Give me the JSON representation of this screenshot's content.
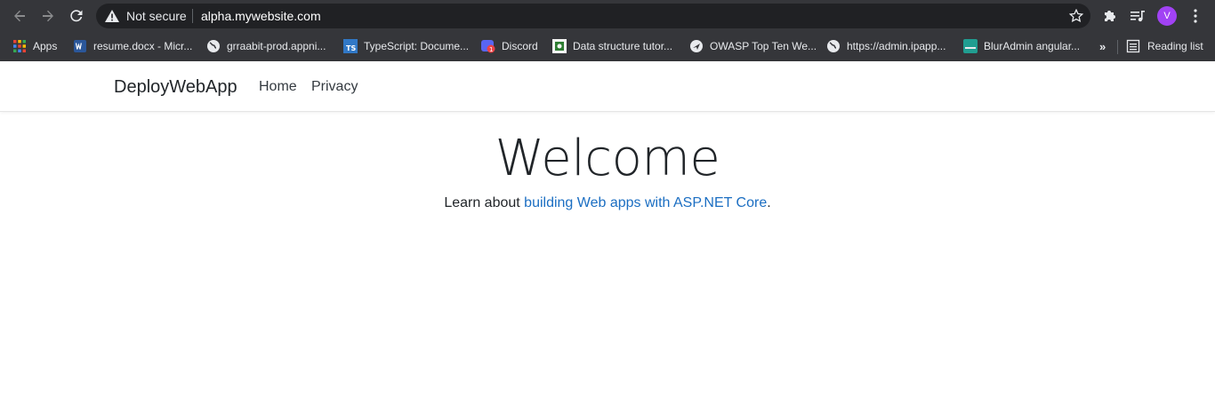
{
  "browser": {
    "security_label": "Not secure",
    "url": "alpha.mywebsite.com",
    "avatar_letter": "V"
  },
  "bookmarks": {
    "items": [
      {
        "label": "Apps",
        "icon": "apps-grid-icon"
      },
      {
        "label": "resume.docx - Micr...",
        "icon": "word-icon"
      },
      {
        "label": "grraabit-prod.appni...",
        "icon": "globe-icon"
      },
      {
        "label": "TypeScript: Docume...",
        "icon": "typescript-icon"
      },
      {
        "label": "Discord",
        "icon": "discord-icon"
      },
      {
        "label": "Data structure tutor...",
        "icon": "tutorial-icon"
      },
      {
        "label": "OWASP Top Ten We...",
        "icon": "owasp-icon"
      },
      {
        "label": "https://admin.ipapp...",
        "icon": "globe-icon"
      },
      {
        "label": "BlurAdmin angular...",
        "icon": "bluradmin-icon"
      }
    ],
    "more": "»",
    "reading_list": "Reading list"
  },
  "site": {
    "brand": "DeployWebApp",
    "nav": {
      "home": "Home",
      "privacy": "Privacy"
    },
    "heading": "Welcome",
    "lead_prefix": "Learn about ",
    "lead_link": "building Web apps with ASP.NET Core",
    "lead_suffix": "."
  },
  "colors": {
    "chrome_bg": "#35363a",
    "omnibox_bg": "#202124",
    "link": "#1b6ec2",
    "avatar": "#a142f4"
  }
}
